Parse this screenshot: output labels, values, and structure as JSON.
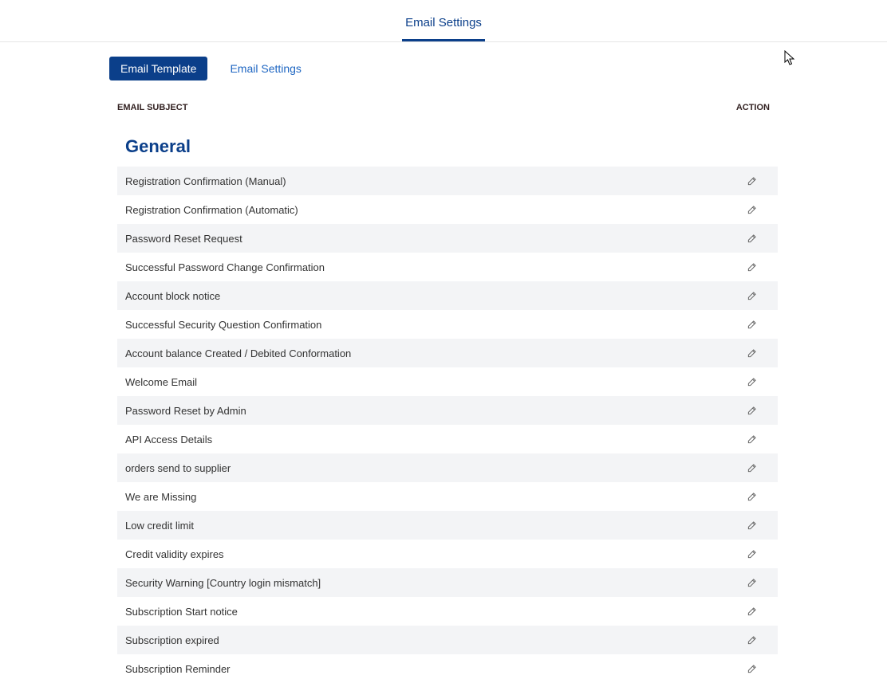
{
  "topTab": {
    "label": "Email Settings"
  },
  "subTabs": {
    "template": "Email Template",
    "settings": "Email Settings"
  },
  "tableHeaders": {
    "subject": "EMAIL SUBJECT",
    "action": "ACTION"
  },
  "sectionTitle": "General",
  "rows": [
    {
      "subject": "Registration Confirmation (Manual)"
    },
    {
      "subject": "Registration Confirmation (Automatic)"
    },
    {
      "subject": "Password Reset Request"
    },
    {
      "subject": "Successful Password Change Confirmation"
    },
    {
      "subject": "Account block notice"
    },
    {
      "subject": "Successful Security Question Confirmation"
    },
    {
      "subject": "Account balance Created / Debited Conformation"
    },
    {
      "subject": "Welcome Email"
    },
    {
      "subject": "Password Reset by Admin"
    },
    {
      "subject": "API Access Details"
    },
    {
      "subject": "orders send to supplier"
    },
    {
      "subject": "We are Missing"
    },
    {
      "subject": "Low credit limit"
    },
    {
      "subject": "Credit validity expires"
    },
    {
      "subject": "Security Warning [Country login mismatch]"
    },
    {
      "subject": "Subscription Start notice"
    },
    {
      "subject": "Subscription expired"
    },
    {
      "subject": "Subscription Reminder"
    }
  ]
}
